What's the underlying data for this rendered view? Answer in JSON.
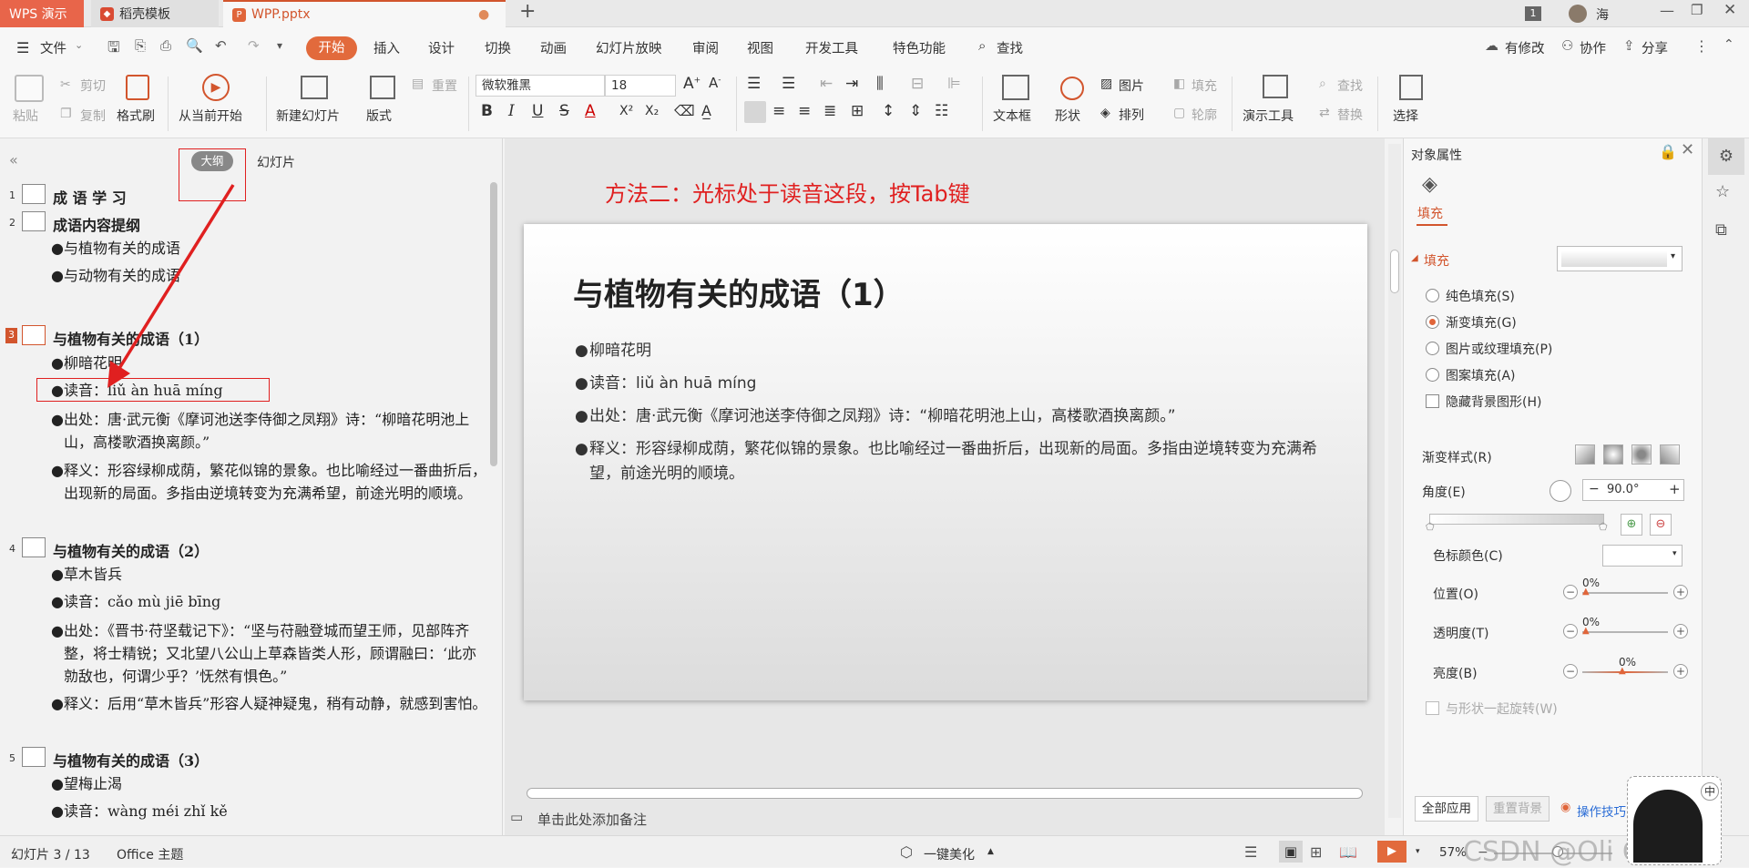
{
  "tabs": {
    "app": "WPS 演示",
    "template": "稻壳模板",
    "doc": "WPP.pptx"
  },
  "window": {
    "page_badge": "1",
    "user": "海"
  },
  "menu": {
    "file": "文件",
    "items": [
      "开始",
      "插入",
      "设计",
      "切换",
      "动画",
      "幻灯片放映",
      "审阅",
      "视图",
      "开发工具",
      "特色功能"
    ],
    "search": "查找",
    "modified": "有修改",
    "collab": "协作",
    "share": "分享"
  },
  "ribbon": {
    "paste": "粘贴",
    "cut": "剪切",
    "copy": "复制",
    "format_painter": "格式刷",
    "from_current": "从当前开始",
    "new_slide": "新建幻灯片",
    "layout": "版式",
    "reset": "重置",
    "font_name": "微软雅黑",
    "font_size": "18",
    "textbox": "文本框",
    "shape": "形状",
    "picture": "图片",
    "arrange": "排列",
    "fill": "填充",
    "outline": "轮廓",
    "present_tools": "演示工具",
    "find": "查找",
    "replace": "替换",
    "select": "选择"
  },
  "left_pane": {
    "tab_outline": "大纲",
    "tab_slides": "幻灯片",
    "entries": [
      {
        "num": "1",
        "title": "成 语 学 习",
        "bullets": []
      },
      {
        "num": "2",
        "title": "成语内容提纲",
        "bullets": [
          "●与植物有关的成语",
          "●与动物有关的成语"
        ]
      },
      {
        "num": "3",
        "title": "与植物有关的成语（1）",
        "bullets": [
          "●柳暗花明",
          "●读音：liǔ àn huā míng",
          "●出处：唐·武元衡《摩诃池送李侍御之凤翔》诗：“柳暗花明池上山，高楼歌酒换离颜。”",
          "●释义：形容绿柳成荫，繁花似锦的景象。也比喻经过一番曲折后，出现新的局面。多指由逆境转变为充满希望，前途光明的顺境。"
        ]
      },
      {
        "num": "4",
        "title": "与植物有关的成语（2）",
        "bullets": [
          "●草木皆兵",
          "●读音：cǎo mù jiē bīng",
          "●出处：《晋书·苻坚载记下》：“坚与苻融登城而望王师，见部阵齐整，将士精锐；又北望八公山上草森皆类人形，顾谓融曰：‘此亦勍敌也，何谓少乎？’怃然有惧色。”",
          "●释义：后用“草木皆兵”形容人疑神疑鬼，稍有动静，就感到害怕。"
        ]
      },
      {
        "num": "5",
        "title": "与植物有关的成语（3）",
        "bullets": [
          "●望梅止渴",
          "●读音：wàng méi zhǐ kě"
        ]
      }
    ]
  },
  "annotation": "方法二：光标处于读音这段，按Tab键",
  "slide": {
    "title": "与植物有关的成语（1）",
    "bullets": [
      "柳暗花明",
      "读音：liǔ àn huā míng",
      "出处：唐·武元衡《摩诃池送李侍御之凤翔》诗：“柳暗花明池上山，高楼歌酒换离颜。”",
      "释义：形容绿柳成荫，繁花似锦的景象。也比喻经过一番曲折后，出现新的局面。多指由逆境转变为充满希望，前途光明的顺境。"
    ]
  },
  "notes_placeholder": "单击此处添加备注",
  "right_pane": {
    "title": "对象属性",
    "fill_tab": "填充",
    "fill_section": "填充",
    "options": [
      "纯色填充(S)",
      "渐变填充(G)",
      "图片或纹理填充(P)",
      "图案填充(A)"
    ],
    "selected_option": "渐变填充(G)",
    "hide_bg": "隐藏背景图形(H)",
    "gradient_style": "渐变样式(R)",
    "angle_label": "角度(E)",
    "angle_value": "90.0°",
    "stop_color": "色标颜色(C)",
    "position": "位置(O)",
    "position_value": "0%",
    "transparency": "透明度(T)",
    "transparency_value": "0%",
    "brightness": "亮度(B)",
    "brightness_value": "0%",
    "rotate_with_shape": "与形状一起旋转(W)",
    "apply_all": "全部应用",
    "reset_bg": "重置背景",
    "tips": "操作技巧"
  },
  "status": {
    "slide_pos": "幻灯片 3 / 13",
    "theme": "Office 主题",
    "beautify": "一键美化",
    "zoom": "57%",
    "watermark": "CSDN @Oli Correct",
    "ime": "中"
  },
  "colors": {
    "accent": "#e26a3c",
    "wps_red": "#e8654a",
    "annotation_red": "#e02020"
  }
}
